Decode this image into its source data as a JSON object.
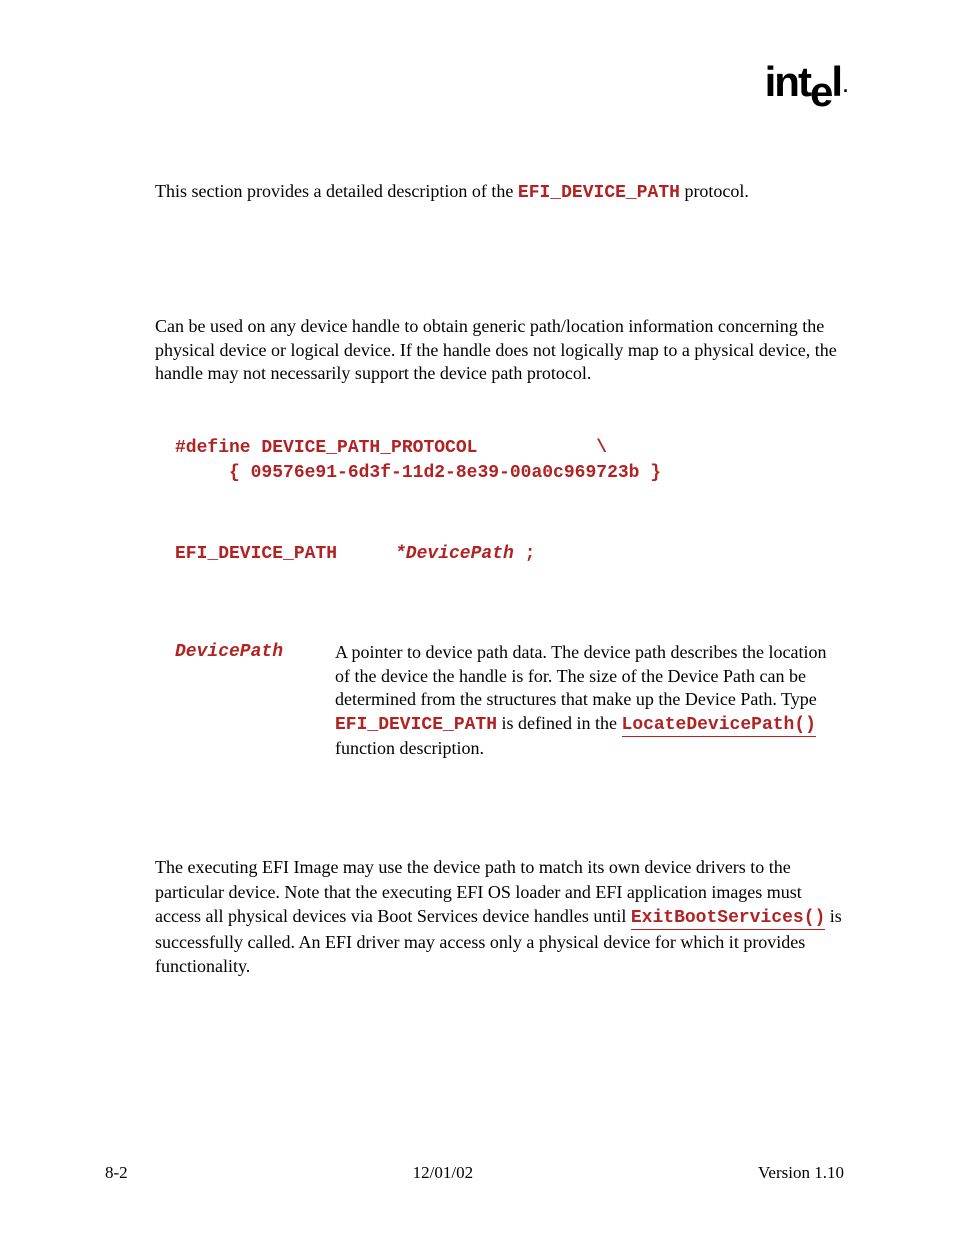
{
  "logo": {
    "part1": "int",
    "drop": "e",
    "part2": "l",
    "dot": "."
  },
  "intro": {
    "pre": "This section provides a detailed description of the ",
    "code": "EFI_DEVICE_PATH",
    "post": " protocol."
  },
  "summary": "Can be used on any device handle to obtain generic path/location information concerning the physical device or logical device.  If the handle does not logically map to a physical device, the handle may not necessarily support the device path protocol.",
  "guid": "#define DEVICE_PATH_PROTOCOL           \\\n     { 09576e91-6d3f-11d2-8e39-00a0c969723b }",
  "proto": {
    "type": "EFI_DEVICE_PATH",
    "var": "*DevicePath",
    "semi": " ;"
  },
  "param": {
    "name": "DevicePath",
    "desc1": "A pointer to device path data.  The device path describes the location of the device the handle is for.  The size of the Device Path can be determined from the structures that make up the Device Path.  Type ",
    "code1": "EFI_DEVICE_PATH",
    "desc2": " is defined in the ",
    "link": "LocateDevicePath()",
    "desc3": " function description."
  },
  "description": {
    "p1": "The executing EFI Image may use the device path to match its own device drivers to the particular device.  Note that the executing EFI OS loader and EFI application images must access all physical devices via Boot Services device handles until ",
    "link": "ExitBootServices()",
    "p2": " is successfully called.  An EFI driver may access only a physical device for which it provides functionality."
  },
  "footer": {
    "left": "8-2",
    "center": "12/01/02",
    "right": "Version 1.10"
  }
}
